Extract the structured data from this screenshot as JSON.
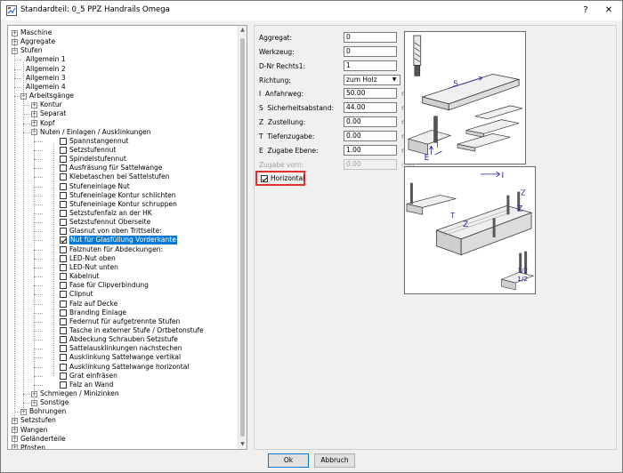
{
  "window": {
    "title": "Standardteil: 0_5 PPZ Handrails Omega",
    "help_glyph": "?",
    "close_glyph": "✕"
  },
  "tree": {
    "nodes": [
      {
        "label": "Maschine",
        "level": 0,
        "expander": "+"
      },
      {
        "label": "Aggregate",
        "level": 0,
        "expander": "+"
      },
      {
        "label": "Stufen",
        "level": 0,
        "expander": "-"
      },
      {
        "label": "Allgemein  1",
        "level": 1,
        "expander": ""
      },
      {
        "label": "Allgemein  2",
        "level": 1,
        "expander": ""
      },
      {
        "label": "Allgemein  3",
        "level": 1,
        "expander": ""
      },
      {
        "label": "Allgemein  4",
        "level": 1,
        "expander": ""
      },
      {
        "label": "Arbeitsgänge",
        "level": 1,
        "expander": "-"
      },
      {
        "label": "Kontur",
        "level": 2,
        "expander": "+"
      },
      {
        "label": "Separat",
        "level": 2,
        "expander": "+"
      },
      {
        "label": "Kopf",
        "level": 2,
        "expander": "+"
      },
      {
        "label": "Nuten / Einlagen / Ausklinkungen",
        "level": 2,
        "expander": "-"
      },
      {
        "label": "Spannstangennut",
        "level": 3,
        "checkbox": true,
        "checked": false
      },
      {
        "label": "Setzstufennut",
        "level": 3,
        "checkbox": true,
        "checked": false
      },
      {
        "label": "Spindelstufennut",
        "level": 3,
        "checkbox": true,
        "checked": false
      },
      {
        "label": "Ausfräsung für Sattelwange",
        "level": 3,
        "checkbox": true,
        "checked": false
      },
      {
        "label": "Klebetaschen bei Sattelstufen",
        "level": 3,
        "checkbox": true,
        "checked": false
      },
      {
        "label": "Stufeneinlage Nut",
        "level": 3,
        "checkbox": true,
        "checked": false
      },
      {
        "label": "Stufeneinlage Kontur schlichten",
        "level": 3,
        "checkbox": true,
        "checked": false
      },
      {
        "label": "Stufeneinlage Kontur schruppen",
        "level": 3,
        "checkbox": true,
        "checked": false
      },
      {
        "label": "Setzstufenfalz an der HK",
        "level": 3,
        "checkbox": true,
        "checked": false
      },
      {
        "label": "Setzstufennut Oberseite",
        "level": 3,
        "checkbox": true,
        "checked": false
      },
      {
        "label": "Glasnut von oben Trittseite:",
        "level": 3,
        "checkbox": true,
        "checked": false
      },
      {
        "label": "Nut für Glasfüllung Vorderkante",
        "level": 3,
        "checkbox": true,
        "checked": true,
        "selected": true
      },
      {
        "label": "Falznuten für Abdeckungen:",
        "level": 3,
        "checkbox": true,
        "checked": false
      },
      {
        "label": "LED-Nut oben",
        "level": 3,
        "checkbox": true,
        "checked": false
      },
      {
        "label": "LED-Nut unten",
        "level": 3,
        "checkbox": true,
        "checked": false
      },
      {
        "label": "Kabelnut",
        "level": 3,
        "checkbox": true,
        "checked": false
      },
      {
        "label": "Fase für Clipverbindung",
        "level": 3,
        "checkbox": true,
        "checked": false
      },
      {
        "label": "Clipnut",
        "level": 3,
        "checkbox": true,
        "checked": false
      },
      {
        "label": "Falz auf Decke",
        "level": 3,
        "checkbox": true,
        "checked": false
      },
      {
        "label": "Branding Einlage",
        "level": 3,
        "checkbox": true,
        "checked": false
      },
      {
        "label": "Federnut für aufgetrennte Stufen",
        "level": 3,
        "checkbox": true,
        "checked": false
      },
      {
        "label": "Tasche in externer Stufe / Ortbetonstufe",
        "level": 3,
        "checkbox": true,
        "checked": false
      },
      {
        "label": "Abdeckung Schrauben Setzstufe",
        "level": 3,
        "checkbox": true,
        "checked": false
      },
      {
        "label": "Sattelausklinkungen nachstechen",
        "level": 3,
        "checkbox": true,
        "checked": false
      },
      {
        "label": "Ausklinkung Sattelwange vertikal",
        "level": 3,
        "checkbox": true,
        "checked": false
      },
      {
        "label": "Ausklinkung Sattelwange horizontal",
        "level": 3,
        "checkbox": true,
        "checked": false
      },
      {
        "label": "Grat einfräsen",
        "level": 3,
        "checkbox": true,
        "checked": false
      },
      {
        "label": "Falz an Wand",
        "level": 3,
        "checkbox": true,
        "checked": false
      },
      {
        "label": "Schmiegen / Minizinken",
        "level": 2,
        "expander": "+"
      },
      {
        "label": "Sonstige",
        "level": 2,
        "expander": "+"
      },
      {
        "label": "Bohrungen",
        "level": 1,
        "expander": "+"
      },
      {
        "label": "Setzstufen",
        "level": 0,
        "expander": "+"
      },
      {
        "label": "Wangen",
        "level": 0,
        "expander": "+"
      },
      {
        "label": "Geländerteile",
        "level": 0,
        "expander": "+"
      },
      {
        "label": "Pfosten",
        "level": 0,
        "expander": "+"
      }
    ]
  },
  "form": {
    "aggregat": {
      "label": "Aggregat:",
      "value": "0"
    },
    "werkzeug": {
      "label": "Werkzeug:",
      "value": "0"
    },
    "dnr": {
      "label": "D-Nr Rechts1:",
      "value": "1"
    },
    "richtung": {
      "label": "Richtung:",
      "value": "zum Holz"
    },
    "anfahrweg": {
      "prefix": "I",
      "label": "Anfahrweg:",
      "value": "50.00",
      "unit": "mm"
    },
    "sicherheit": {
      "prefix": "S",
      "label": "Sicherheitsabstand:",
      "value": "44.00",
      "unit": "mm"
    },
    "zustellung": {
      "prefix": "Z",
      "label": "Zustellung:",
      "value": "0.00",
      "unit": "mm"
    },
    "tiefe": {
      "prefix": "T",
      "label": "Tiefenzugabe:",
      "value": "0.00",
      "unit": "mm"
    },
    "zugabe_ebene": {
      "prefix": "E",
      "label": "Zugabe Ebene:",
      "value": "1.00",
      "unit": "mm"
    },
    "zugabe_vorn": {
      "label": "Zugabe vorn:",
      "value": "0.00",
      "unit": "mm"
    },
    "horizontal": {
      "label": "Horizontal",
      "checked": true
    }
  },
  "illustrations": {
    "top_labels": {
      "s": "S",
      "e": "E",
      "i": "I"
    },
    "bottom_labels": {
      "i": "I",
      "z1": "Z",
      "t": "T",
      "z2": "Z",
      "z3": "Z",
      "half": "1/2",
      "half2": "1/2"
    }
  },
  "buttons": {
    "ok": "Ok",
    "cancel": "Abbruch"
  },
  "colors": {
    "selection": "#0078d7",
    "highlight_border": "#e03030",
    "annotation": "#2020a0"
  }
}
